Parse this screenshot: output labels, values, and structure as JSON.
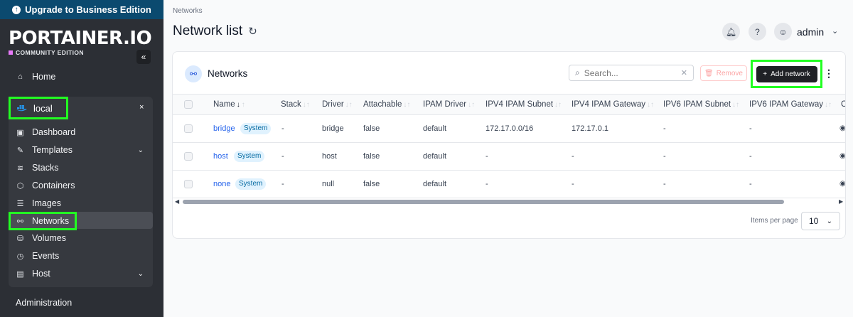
{
  "upgrade_banner": "Upgrade to Business Edition",
  "logo": {
    "text": "PORTAINER.IO",
    "edition": "COMMUNITY EDITION",
    "collapse_icon": "«"
  },
  "sidebar": {
    "home": "Home",
    "environment": {
      "name": "local",
      "close": "×"
    },
    "items": [
      {
        "label": "Dashboard",
        "icon": "dashboard-icon"
      },
      {
        "label": "Templates",
        "icon": "templates-icon"
      },
      {
        "label": "Stacks",
        "icon": "stacks-icon"
      },
      {
        "label": "Containers",
        "icon": "containers-icon"
      },
      {
        "label": "Images",
        "icon": "images-icon"
      },
      {
        "label": "Networks",
        "icon": "networks-icon"
      },
      {
        "label": "Volumes",
        "icon": "volumes-icon"
      },
      {
        "label": "Events",
        "icon": "events-icon"
      },
      {
        "label": "Host",
        "icon": "host-icon"
      }
    ],
    "administration": "Administration"
  },
  "breadcrumb": "Networks",
  "page_title": "Network list",
  "user": {
    "name": "admin"
  },
  "panel": {
    "title": "Networks",
    "search_placeholder": "Search...",
    "remove_label": "Remove",
    "add_label": "Add network",
    "columns": [
      "Name",
      "Stack",
      "Driver",
      "Attachable",
      "IPAM Driver",
      "IPV4 IPAM Subnet",
      "IPV4 IPAM Gateway",
      "IPV6 IPAM Subnet",
      "IPV6 IPAM Gateway",
      "C"
    ],
    "rows": [
      {
        "name": "bridge",
        "badge": "System",
        "stack": "-",
        "driver": "bridge",
        "attachable": "false",
        "ipam_driver": "default",
        "ipv4_subnet": "172.17.0.0/16",
        "ipv4_gateway": "172.17.0.1",
        "ipv6_subnet": "-",
        "ipv6_gateway": "-"
      },
      {
        "name": "host",
        "badge": "System",
        "stack": "-",
        "driver": "host",
        "attachable": "false",
        "ipam_driver": "default",
        "ipv4_subnet": "-",
        "ipv4_gateway": "-",
        "ipv6_subnet": "-",
        "ipv6_gateway": "-"
      },
      {
        "name": "none",
        "badge": "System",
        "stack": "-",
        "driver": "null",
        "attachable": "false",
        "ipam_driver": "default",
        "ipv4_subnet": "-",
        "ipv4_gateway": "-",
        "ipv6_subnet": "-",
        "ipv6_gateway": "-"
      }
    ],
    "items_per_page_label": "Items per page",
    "items_per_page_value": "10"
  },
  "colors": {
    "sidebar_bg": "#2c2f35",
    "banner_bg": "#0b4a6f",
    "highlight": "#22ff22",
    "link": "#2563eb"
  }
}
